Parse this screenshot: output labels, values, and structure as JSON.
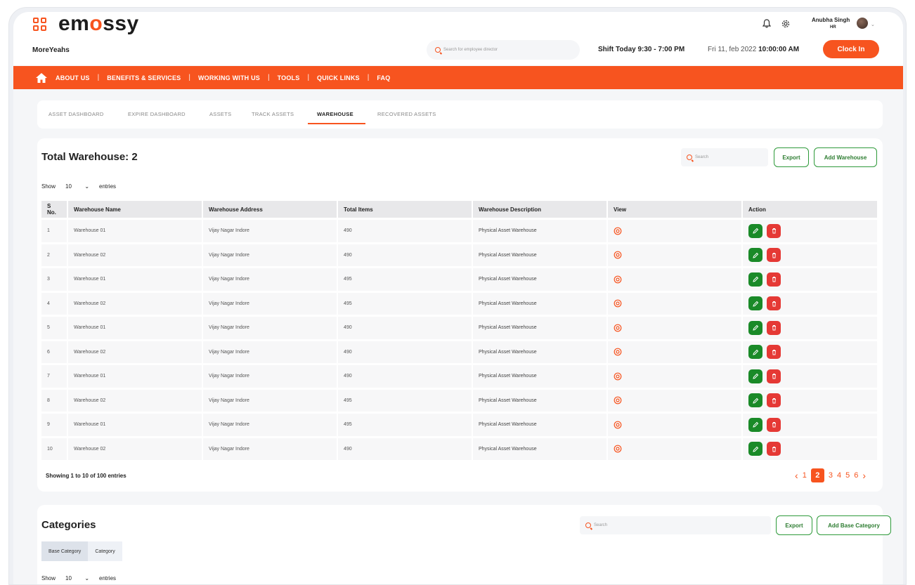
{
  "brand": {
    "logo_text_a": "em",
    "logo_text_o": "o",
    "logo_text_b": "ssy"
  },
  "header": {
    "company": "MoreYeahs",
    "search_placeholder": "Search for employee director",
    "shift": "Shift Today 9:30 - 7:00 PM",
    "date_prefix": "Fri 11, feb 2022",
    "time": "10:00:00 AM",
    "clock_in_label": "Clock In",
    "user_name": "Anubha Singh",
    "user_role": "HR"
  },
  "nav": {
    "items": [
      "ABOUT US",
      "BENEFITS & SERVICES",
      "WORKING WITH US",
      "TOOLS",
      "QUICK LINKS",
      "FAQ"
    ]
  },
  "tabs": [
    "ASSET DASHBOARD",
    "EXPIRE DASHBOARD",
    "ASSETS",
    "TRACK ASSETS",
    "WAREHOUSE",
    "RECOVERED ASSETS"
  ],
  "active_tab": "WAREHOUSE",
  "warehouse": {
    "title": "Total Warehouse: 2",
    "search_placeholder": "Search",
    "export_label": "Export",
    "add_label": "Add Warehouse",
    "show_label": "Show",
    "show_value": "10",
    "entries_label": "entries",
    "columns": [
      "S No.",
      "Warehouse Name",
      "Warehouse Address",
      "Total Items",
      "Warehouse Description",
      "View",
      "Action"
    ],
    "rows": [
      [
        "1",
        "Warehouse 01",
        "Vijay Nagar Indore",
        "490",
        "Physical Asset Warehouse"
      ],
      [
        "2",
        "Warehouse 02",
        "Vijay Nagar Indore",
        "490",
        "Physical Asset Warehouse"
      ],
      [
        "3",
        "Warehouse 01",
        "Vijay Nagar Indore",
        "495",
        "Physical Asset Warehouse"
      ],
      [
        "4",
        "Warehouse 02",
        "Vijay Nagar Indore",
        "495",
        "Physical Asset Warehouse"
      ],
      [
        "5",
        "Warehouse 01",
        "Vijay Nagar Indore",
        "490",
        "Physical Asset Warehouse"
      ],
      [
        "6",
        "Warehouse 02",
        "Vijay Nagar Indore",
        "490",
        "Physical Asset Warehouse"
      ],
      [
        "7",
        "Warehouse 01",
        "Vijay Nagar Indore",
        "490",
        "Physical Asset Warehouse"
      ],
      [
        "8",
        "Warehouse 02",
        "Vijay Nagar Indore",
        "495",
        "Physical Asset Warehouse"
      ],
      [
        "9",
        "Warehouse 01",
        "Vijay Nagar Indore",
        "495",
        "Physical Asset Warehouse"
      ],
      [
        "10",
        "Warehouse 02",
        "Vijay Nagar Indore",
        "490",
        "Physical Asset Warehouse"
      ]
    ],
    "showing_text": "Showing 1 to 10 of 100 entries",
    "pages": [
      "1",
      "2",
      "3",
      "4",
      "5",
      "6"
    ],
    "current_page": "2"
  },
  "categories": {
    "title": "Categories",
    "search_placeholder": "Search",
    "export_label": "Export",
    "add_label": "Add Base Category",
    "tabs": [
      "Base Category",
      "Category"
    ],
    "show_label": "Show",
    "show_value": "10",
    "entries_label": "entries"
  },
  "colors": {
    "accent": "#f7541f",
    "success": "#1a8a28",
    "danger": "#e53935"
  }
}
